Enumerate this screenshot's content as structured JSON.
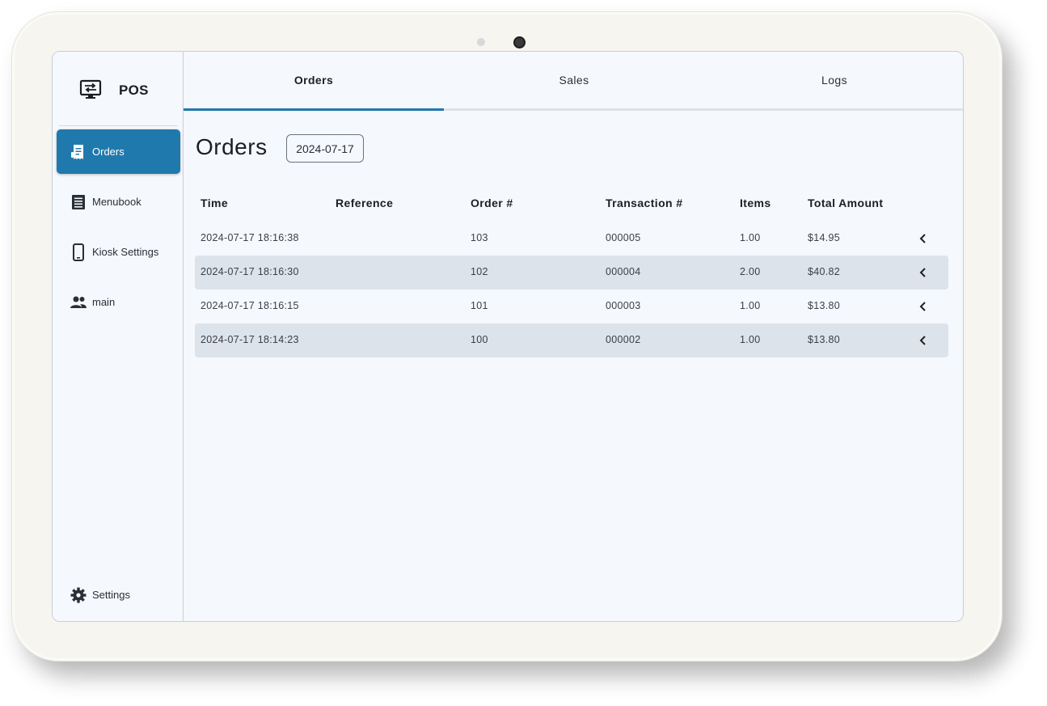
{
  "app": {
    "title": "POS"
  },
  "sidebar": {
    "items": [
      {
        "label": "Orders",
        "icon": "receipt-icon",
        "active": true
      },
      {
        "label": "Menubook",
        "icon": "menu-list-icon",
        "active": false
      },
      {
        "label": "Kiosk Settings",
        "icon": "tablet-icon",
        "active": false
      },
      {
        "label": "main",
        "icon": "users-icon",
        "active": false
      }
    ],
    "settings_label": "Settings"
  },
  "tabs": [
    {
      "label": "Orders",
      "active": true
    },
    {
      "label": "Sales",
      "active": false
    },
    {
      "label": "Logs",
      "active": false
    }
  ],
  "main": {
    "title": "Orders",
    "date": "2024-07-17"
  },
  "table": {
    "headers": {
      "time": "Time",
      "reference": "Reference",
      "order": "Order #",
      "transaction": "Transaction #",
      "items": "Items",
      "total": "Total Amount"
    },
    "rows": [
      {
        "time": "2024-07-17 18:16:38",
        "reference": "",
        "order": "103",
        "transaction": "000005",
        "items": "1.00",
        "total": "$14.95"
      },
      {
        "time": "2024-07-17 18:16:30",
        "reference": "",
        "order": "102",
        "transaction": "000004",
        "items": "2.00",
        "total": "$40.82"
      },
      {
        "time": "2024-07-17 18:16:15",
        "reference": "",
        "order": "101",
        "transaction": "000003",
        "items": "1.00",
        "total": "$13.80"
      },
      {
        "time": "2024-07-17 18:14:23",
        "reference": "",
        "order": "100",
        "transaction": "000002",
        "items": "1.00",
        "total": "$13.80"
      }
    ]
  },
  "colors": {
    "accent": "#2079ad",
    "row_alt": "#dde3ea",
    "screen_bg": "#f5f8fc"
  }
}
